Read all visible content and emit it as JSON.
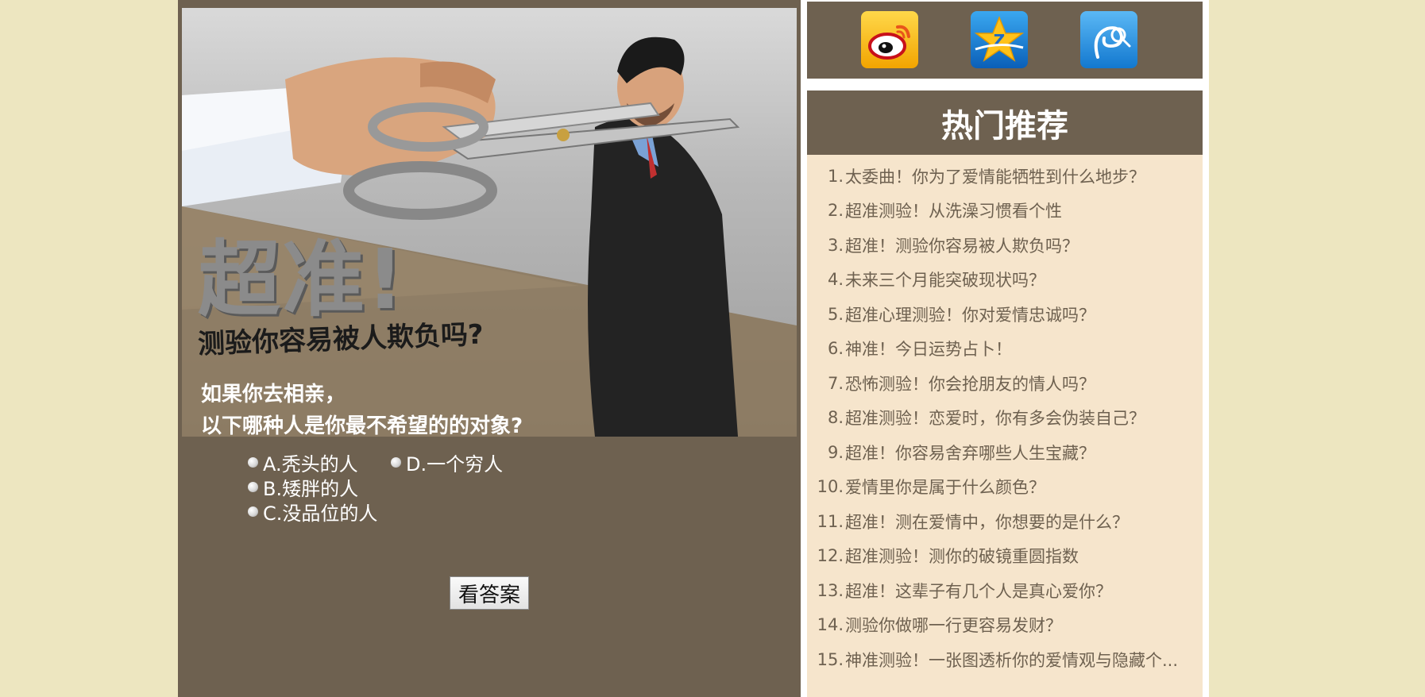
{
  "banner": {
    "title": "超准!",
    "subtitle": "测验你容易被人欺负吗?",
    "question_line1": "如果你去相亲，",
    "question_line2": "以下哪种人是你最不希望的的对象?"
  },
  "options": [
    {
      "label": "A.秃头的人"
    },
    {
      "label": "B.矮胖的人"
    },
    {
      "label": "C.没品位的人"
    },
    {
      "label": "D.一个穷人"
    }
  ],
  "answer_button": {
    "label": "看答案"
  },
  "share": {
    "icons": [
      "weibo-icon",
      "qzone-icon",
      "tencent-weibo-icon"
    ]
  },
  "hot": {
    "title": "热门推荐",
    "items": [
      {
        "num": "1.",
        "text": "太委曲！你为了爱情能牺牲到什么地步？"
      },
      {
        "num": "2.",
        "text": "超准测验！从洗澡习惯看个性"
      },
      {
        "num": "3.",
        "text": "超准！测验你容易被人欺负吗？"
      },
      {
        "num": "4.",
        "text": "未来三个月能突破现状吗？"
      },
      {
        "num": "5.",
        "text": "超准心理测验！你对爱情忠诚吗？"
      },
      {
        "num": "6.",
        "text": "神准！今日运势占卜！"
      },
      {
        "num": "7.",
        "text": "恐怖测验！你会抢朋友的情人吗？"
      },
      {
        "num": "8.",
        "text": "超准测验！恋爱时，你有多会伪装自己？"
      },
      {
        "num": "9.",
        "text": "超准！你容易舍弃哪些人生宝藏？"
      },
      {
        "num": "10.",
        "text": "爱情里你是属于什么颜色？"
      },
      {
        "num": "11.",
        "text": "超准！测在爱情中，你想要的是什么？"
      },
      {
        "num": "12.",
        "text": "超准测验！测你的破镜重圆指数"
      },
      {
        "num": "13.",
        "text": "超准！这辈子有几个人是真心爱你？"
      },
      {
        "num": "14.",
        "text": "测验你做哪一行更容易发财？"
      },
      {
        "num": "15.",
        "text": "神准测验！一张图透析你的爱情观与隐藏个..."
      }
    ]
  },
  "colors": {
    "background": "#ede6c0",
    "panel": "#6e6150",
    "list_bg": "#f6e5cc",
    "list_text": "#6e6150"
  }
}
